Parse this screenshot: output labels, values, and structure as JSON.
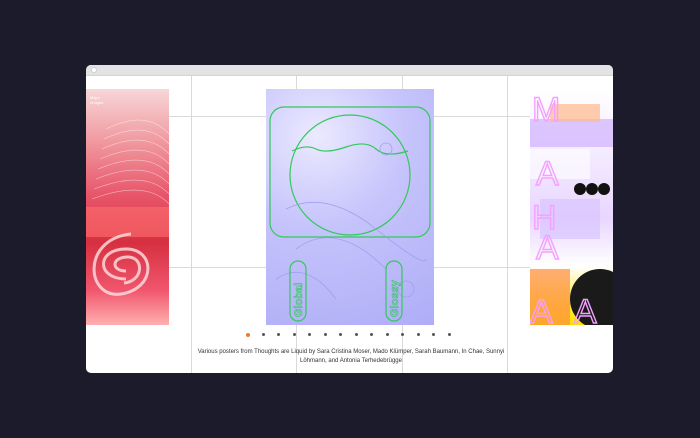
{
  "caption": "Various posters from Thoughts are Liquid by Sara Cristina Moser, Mado Klümper, Sarah Baumann, In Chae, Sunnyi Löhmann, and Antonia Terhedebrügge",
  "carousel": {
    "slide_count": 14,
    "active_index": 0
  },
  "posters": {
    "left_text": "Major\nImages",
    "center_words": [
      "Global",
      "Glossy"
    ],
    "right_letters": [
      "M",
      "A",
      "H",
      "A",
      "A",
      "A"
    ]
  },
  "colors": {
    "page_bg": "#1b1b2b",
    "accent": "#f07a2a",
    "poster_green": "#32c85a",
    "poster_lilac": "#aeadf7",
    "poster_pink": "#e8556a"
  }
}
